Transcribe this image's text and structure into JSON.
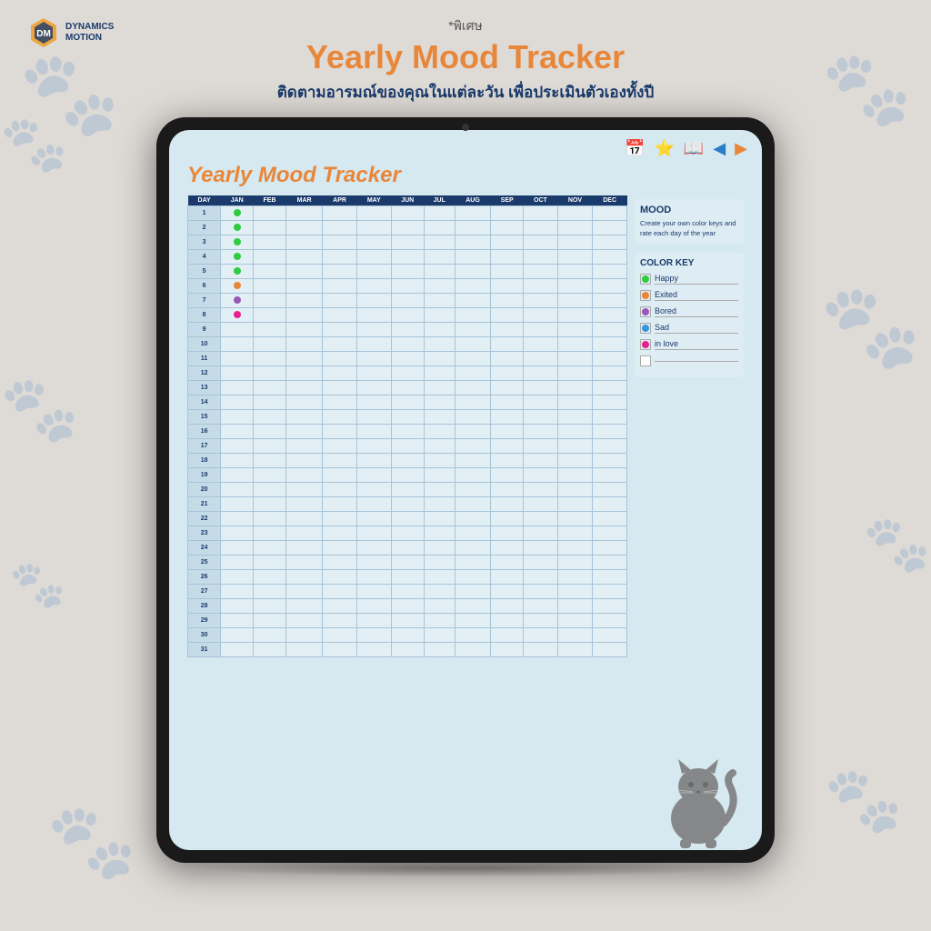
{
  "brand": {
    "name": "DYNAMICS\nMOTION"
  },
  "header": {
    "special": "*พิเศษ",
    "title_black": "Yearly ",
    "title_orange": "Mood Tracker",
    "subtitle": "ติดตามอารมณ์ของคุณในแต่ละวัน เพื่อประเมินตัวเองทั้งปี"
  },
  "page": {
    "title_black": "Yearly ",
    "title_orange": "Mood Tracker"
  },
  "toolbar": {
    "icons": [
      "calendar",
      "star",
      "book",
      "arrow-left",
      "arrow-right"
    ]
  },
  "mood_section": {
    "title": "MOOD",
    "description": "Create your own color keys and rate each day of the year"
  },
  "color_key": {
    "title": "COLOR KEY",
    "items": [
      {
        "label": "Happy",
        "color": "#2ecc40"
      },
      {
        "label": "Exited",
        "color": "#e8873a"
      },
      {
        "label": "Bored",
        "color": "#9b59b6"
      },
      {
        "label": "Sad",
        "color": "#3498db"
      },
      {
        "label": "in love",
        "color": "#e91e8c"
      },
      {
        "label": "",
        "color": ""
      }
    ]
  },
  "table": {
    "headers": [
      "DAY",
      "JAN",
      "FEB",
      "MAR",
      "APR",
      "MAY",
      "JUN",
      "JUL",
      "AUG",
      "SEP",
      "OCT",
      "NOV",
      "DEC"
    ],
    "days": [
      1,
      2,
      3,
      4,
      5,
      6,
      7,
      8,
      9,
      10,
      11,
      12,
      13,
      14,
      15,
      16,
      17,
      18,
      19,
      20,
      21,
      22,
      23,
      24,
      25,
      26,
      27,
      28,
      29,
      30,
      31
    ],
    "mood_data": {
      "1": {
        "JAN": "happy"
      },
      "2": {
        "JAN": "happy"
      },
      "3": {
        "JAN": "happy"
      },
      "4": {
        "JAN": "happy"
      },
      "5": {
        "JAN": "happy"
      },
      "6": {
        "JAN": "exited"
      },
      "7": {
        "JAN": "bored"
      },
      "8": {
        "JAN": "in_love"
      }
    }
  }
}
